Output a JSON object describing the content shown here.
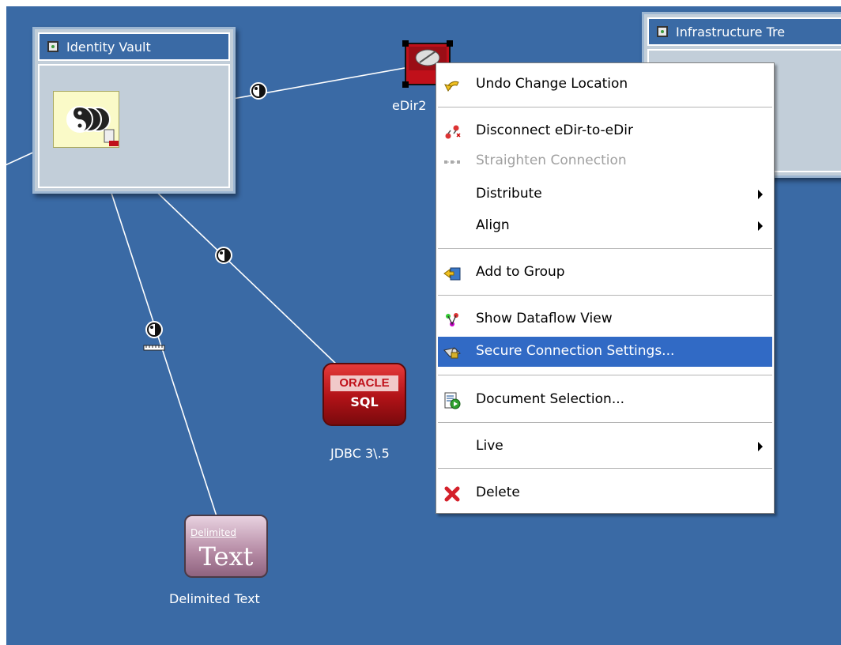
{
  "vaults": {
    "identity_vault": {
      "title": "Identity Vault"
    },
    "infrastructure": {
      "title": "Infrastructure Tre"
    }
  },
  "drivers": {
    "edir": {
      "label": "eDir2"
    },
    "jdbc": {
      "label": "JDBC 3\\.5",
      "logo_top": "ORACLE",
      "logo_bottom": "SQL"
    },
    "delimited": {
      "label": "Delimited Text",
      "logo_top": "Delimited",
      "logo_bottom": "Text"
    }
  },
  "context_menu": {
    "items": [
      {
        "label": "Undo Change Location",
        "icon": "undo-icon",
        "enabled": true
      },
      {
        "label": "Disconnect eDir-to-eDir",
        "icon": "disconnect-icon",
        "enabled": true
      },
      {
        "label": "Straighten Connection",
        "icon": "straighten-icon",
        "enabled": false
      },
      {
        "label": "Distribute",
        "icon": "",
        "enabled": true,
        "submenu": true
      },
      {
        "label": "Align",
        "icon": "",
        "enabled": true,
        "submenu": true
      },
      {
        "label": "Add to Group",
        "icon": "add-to-group-icon",
        "enabled": true
      },
      {
        "label": "Show Dataflow View",
        "icon": "dataflow-icon",
        "enabled": true
      },
      {
        "label": "Secure Connection Settings...",
        "icon": "secure-connection-icon",
        "enabled": true,
        "selected": true
      },
      {
        "label": "Document Selection...",
        "icon": "document-icon",
        "enabled": true
      },
      {
        "label": "Live",
        "icon": "",
        "enabled": true,
        "submenu": true
      },
      {
        "label": "Delete",
        "icon": "delete-icon",
        "enabled": true
      }
    ]
  },
  "colors": {
    "canvas": "#3a6aa5",
    "menu_highlight": "#316ac5",
    "vault_body": "#c2ced9"
  }
}
